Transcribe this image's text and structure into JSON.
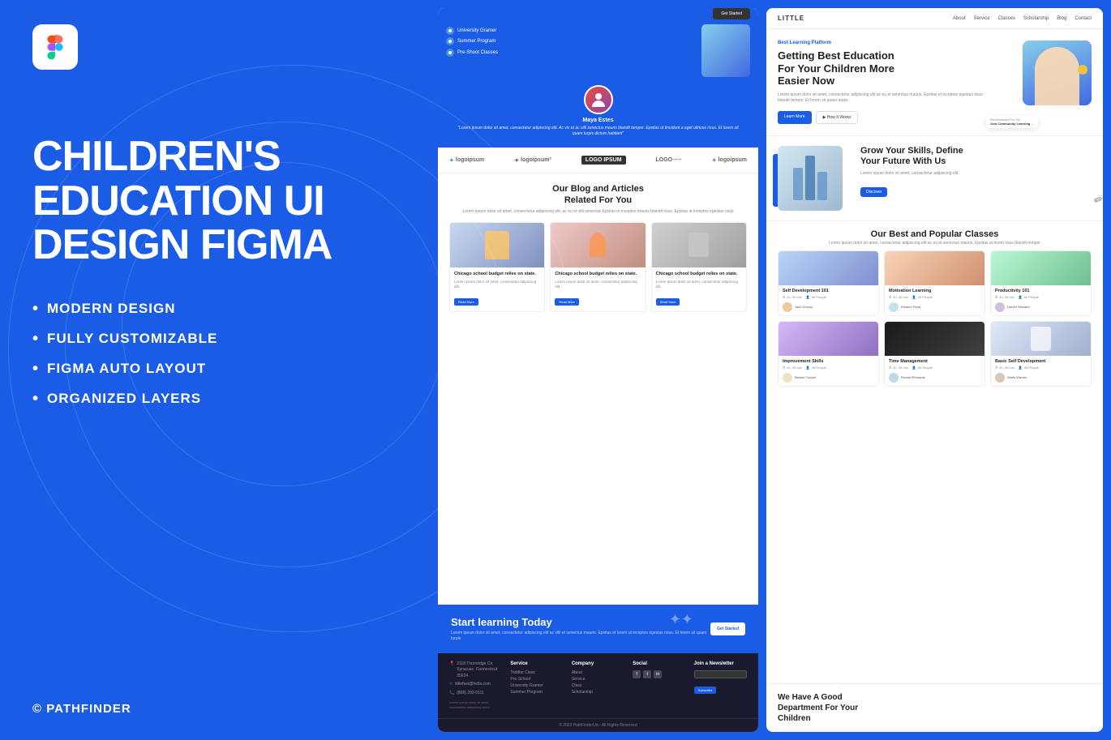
{
  "left": {
    "logo_alt": "Figma Logo",
    "title": "CHILDREN'S\nEDUCATION\nUI DESIGN\nFIGMA",
    "features": [
      "MODERN DESIGN",
      "FULLY  CUSTOMIZABLE",
      "FIGMA AUTO LAYOUT",
      "ORGANIZED LAYERS"
    ],
    "copyright": "© PATHFINDER"
  },
  "middle": {
    "avatar_name": "Maya Estes",
    "avatar_quote": "\"Lorem ipsum dolor sit amet, consectetur adipiscing elit. Ac vix et ac villi senectus mauris blandit tempor. Epsitas ut tincidunt a eget ultrices risus. Et lorem sit quam turpis dictum habitant\"",
    "logos": [
      "logoipsum",
      "logoipsum²",
      "LOGO IPSUM",
      "LOGO·····",
      "logoipsum"
    ],
    "blog_title": "Our Blog and Articles\nRelated For You",
    "blog_subtitle": "Lorem ipsum dolor sit amet, consectetur adipiscing elit, ac eu et villi senectus Epsitas et inceptos mauris blandit risus. Epsitas at inceptos egestas risus",
    "blog_cards": [
      {
        "title": "Chicago school budget relies on state.",
        "text": "Lorem ipsum dolor sit amet, consectetur adipiscing elit.",
        "btn": "Read More"
      },
      {
        "title": "Chicago school budget relies on state.",
        "text": "Lorem ipsum dolor sit amet, consectetur adipiscing elit.",
        "btn": "Read More"
      },
      {
        "title": "Chicago school budget relies on state.",
        "text": "Lorem ipsum dolor sit amet, consectetur adipiscing elit.",
        "btn": "Read More"
      }
    ],
    "cta_title": "Start learning Today",
    "cta_desc": "Lorem ipsum dolor sit amet, consectetur adipiscing elit ac villi et senectus mauris. Epsitas et lorem ut inceptos egestas risus. Et lorem sit quam turpis",
    "cta_btn": "Get Started",
    "footer": {
      "address": "2118 Thornridge Cir. Syracuse,\nConnecticut 35624",
      "email": "littlefeet@hella.com",
      "phone": "(888) 393-0111",
      "service_title": "Service",
      "service_items": [
        "Toddler Class",
        "Pre-School",
        "University Gramer",
        "Summer Program"
      ],
      "company_title": "Company",
      "company_items": [
        "About",
        "Service",
        "Class",
        "Scholarship"
      ],
      "social_title": "Social",
      "newsletter_title": "Join a Newsletter",
      "newsletter_btn": "Subscribe",
      "bottom_text": "© 2023 PathFinderUd - All Rights Reserved"
    }
  },
  "right": {
    "nav": {
      "logo": "LITTLE",
      "links": [
        "About",
        "Service",
        "Classes",
        "Scholarship",
        "Blog",
        "Contact"
      ]
    },
    "hero": {
      "tag": "Best Learning Platform",
      "title": "Getting Best Education\nFor Your Children More\nEasier Now",
      "desc": "Lorem ipsum dolor sit amet, consectetur adipiscing elit ac eu et senectus mauris. Epsitas et inceptos egestas risus blandit tempor. Et lorem sit quam turpis",
      "btn_primary": "Learn More",
      "btn_secondary": "▶ How It Works",
      "join_label": "Join Community Learning →"
    },
    "skills": {
      "title": "Grow Your Skills, Define\nYour Future With Us",
      "desc": "Lorem ipsum dolor sit amet, consectetur adipiscing elit.",
      "btn": "Discover"
    },
    "classes": {
      "title": "Our Best and Popular Classes",
      "desc": "Lorem ipsum dolor sit amet, consectetur adipiscing elit ac eu et senectus mauris. Epsitas et lorem risus blandit tempor",
      "items": [
        {
          "title": "Self Development 101",
          "duration": "2h, 30 min",
          "people": "55 People",
          "author": "Jack Dorsey",
          "img_color": "img-blue"
        },
        {
          "title": "Motivation Learning",
          "duration": "2h, 30 min",
          "people": "35 People",
          "author": "Eleanor Pena",
          "img_color": "img-orange"
        },
        {
          "title": "Productivity 101",
          "duration": "2h, 30 min",
          "people": "80 People",
          "author": "Darrell Steward",
          "img_color": "img-green"
        },
        {
          "title": "Improvement Skills",
          "duration": "2h, 30 min",
          "people": "45 People",
          "author": "Bessie Cooper",
          "img_color": "img-purple"
        },
        {
          "title": "Time Management",
          "duration": "2h, 30 min",
          "people": "60 People",
          "author": "Ronald Richards",
          "img_color": "img-yellow"
        },
        {
          "title": "Basic Self Development",
          "duration": "2h, 30 min",
          "people": "58 People",
          "author": "Wade Warren",
          "img_color": "img-teal"
        }
      ]
    },
    "bottom_title": "We Have A Good\nDepartment For Your\nChildren"
  },
  "top_partial": {
    "items": [
      "University Gramer",
      "Summer Program"
    ],
    "items2": [
      "Pre-Shoot Classes"
    ],
    "btn": "Get Started"
  }
}
